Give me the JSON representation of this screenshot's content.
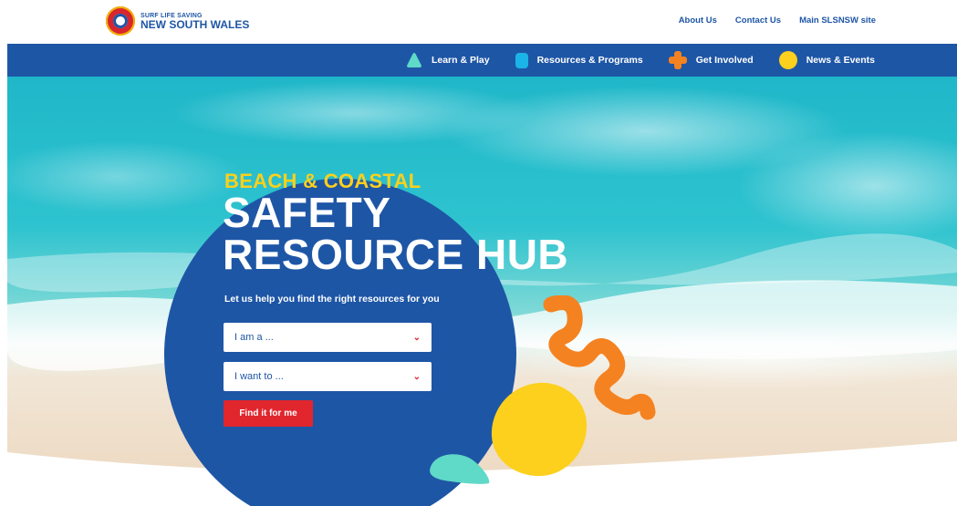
{
  "header": {
    "logo": {
      "line1": "SURF LIFE SAVING",
      "line2": "NEW SOUTH WALES"
    },
    "utility_links": [
      "About Us",
      "Contact Us",
      "Main SLSNSW site"
    ]
  },
  "nav": {
    "items": [
      {
        "label": "Learn & Play",
        "icon": "triangle-icon",
        "color": "#5fd9c8"
      },
      {
        "label": "Resources & Programs",
        "icon": "square-icon",
        "color": "#1ab4e8"
      },
      {
        "label": "Get Involved",
        "icon": "plus-icon",
        "color": "#f58220"
      },
      {
        "label": "News & Events",
        "icon": "circle-icon",
        "color": "#fcd01c"
      }
    ]
  },
  "hero": {
    "kicker": "BEACH & COASTAL",
    "title_line1": "SAFETY",
    "title_line2": "RESOURCE HUB",
    "tagline": "Let us help you find the right resources for you",
    "select_role": "I am a ...",
    "select_goal": "I want to ...",
    "cta": "Find it for me"
  },
  "colors": {
    "brand_blue": "#1e56a6",
    "accent_yellow": "#fcd01c",
    "accent_red": "#e1262d",
    "accent_orange": "#f58220",
    "accent_teal": "#5fd9c8"
  }
}
